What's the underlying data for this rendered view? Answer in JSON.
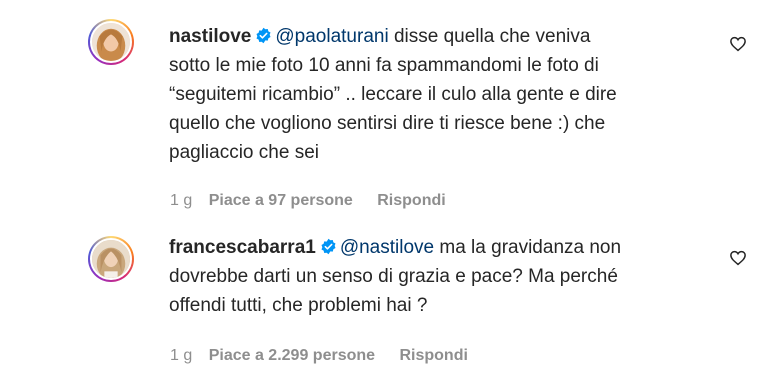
{
  "comments": [
    {
      "username": "nastilove",
      "mention": "@paolaturani",
      "lines": [
        " disse quella che veniva",
        "sotto le mie foto 10 anni fa spammandomi le foto di",
        "“seguitemi ricambio” .. leccare il culo alla gente e dire",
        "quello che vogliono sentirsi dire ti riesce bene :) che",
        "pagliaccio che sei"
      ],
      "time": "1 g",
      "likes": "Piace a 97 persone",
      "reply": "Rispondi"
    },
    {
      "username": "francescabarra1",
      "mention": "@nastilove",
      "lines": [
        " ma la gravidanza non",
        "dovrebbe darti un senso di grazia e pace? Ma perché",
        "offendi tutti, che problemi hai ?"
      ],
      "time": "1 g",
      "likes": "Piace a 2.299 persone",
      "reply": "Rispondi"
    }
  ],
  "icons": {
    "verified": "verified-badge-icon",
    "like": "heart-outline-icon"
  },
  "colors": {
    "verified": "#0095f6",
    "mention": "#00376b",
    "meta": "#8e8e8e",
    "text": "#262626"
  }
}
